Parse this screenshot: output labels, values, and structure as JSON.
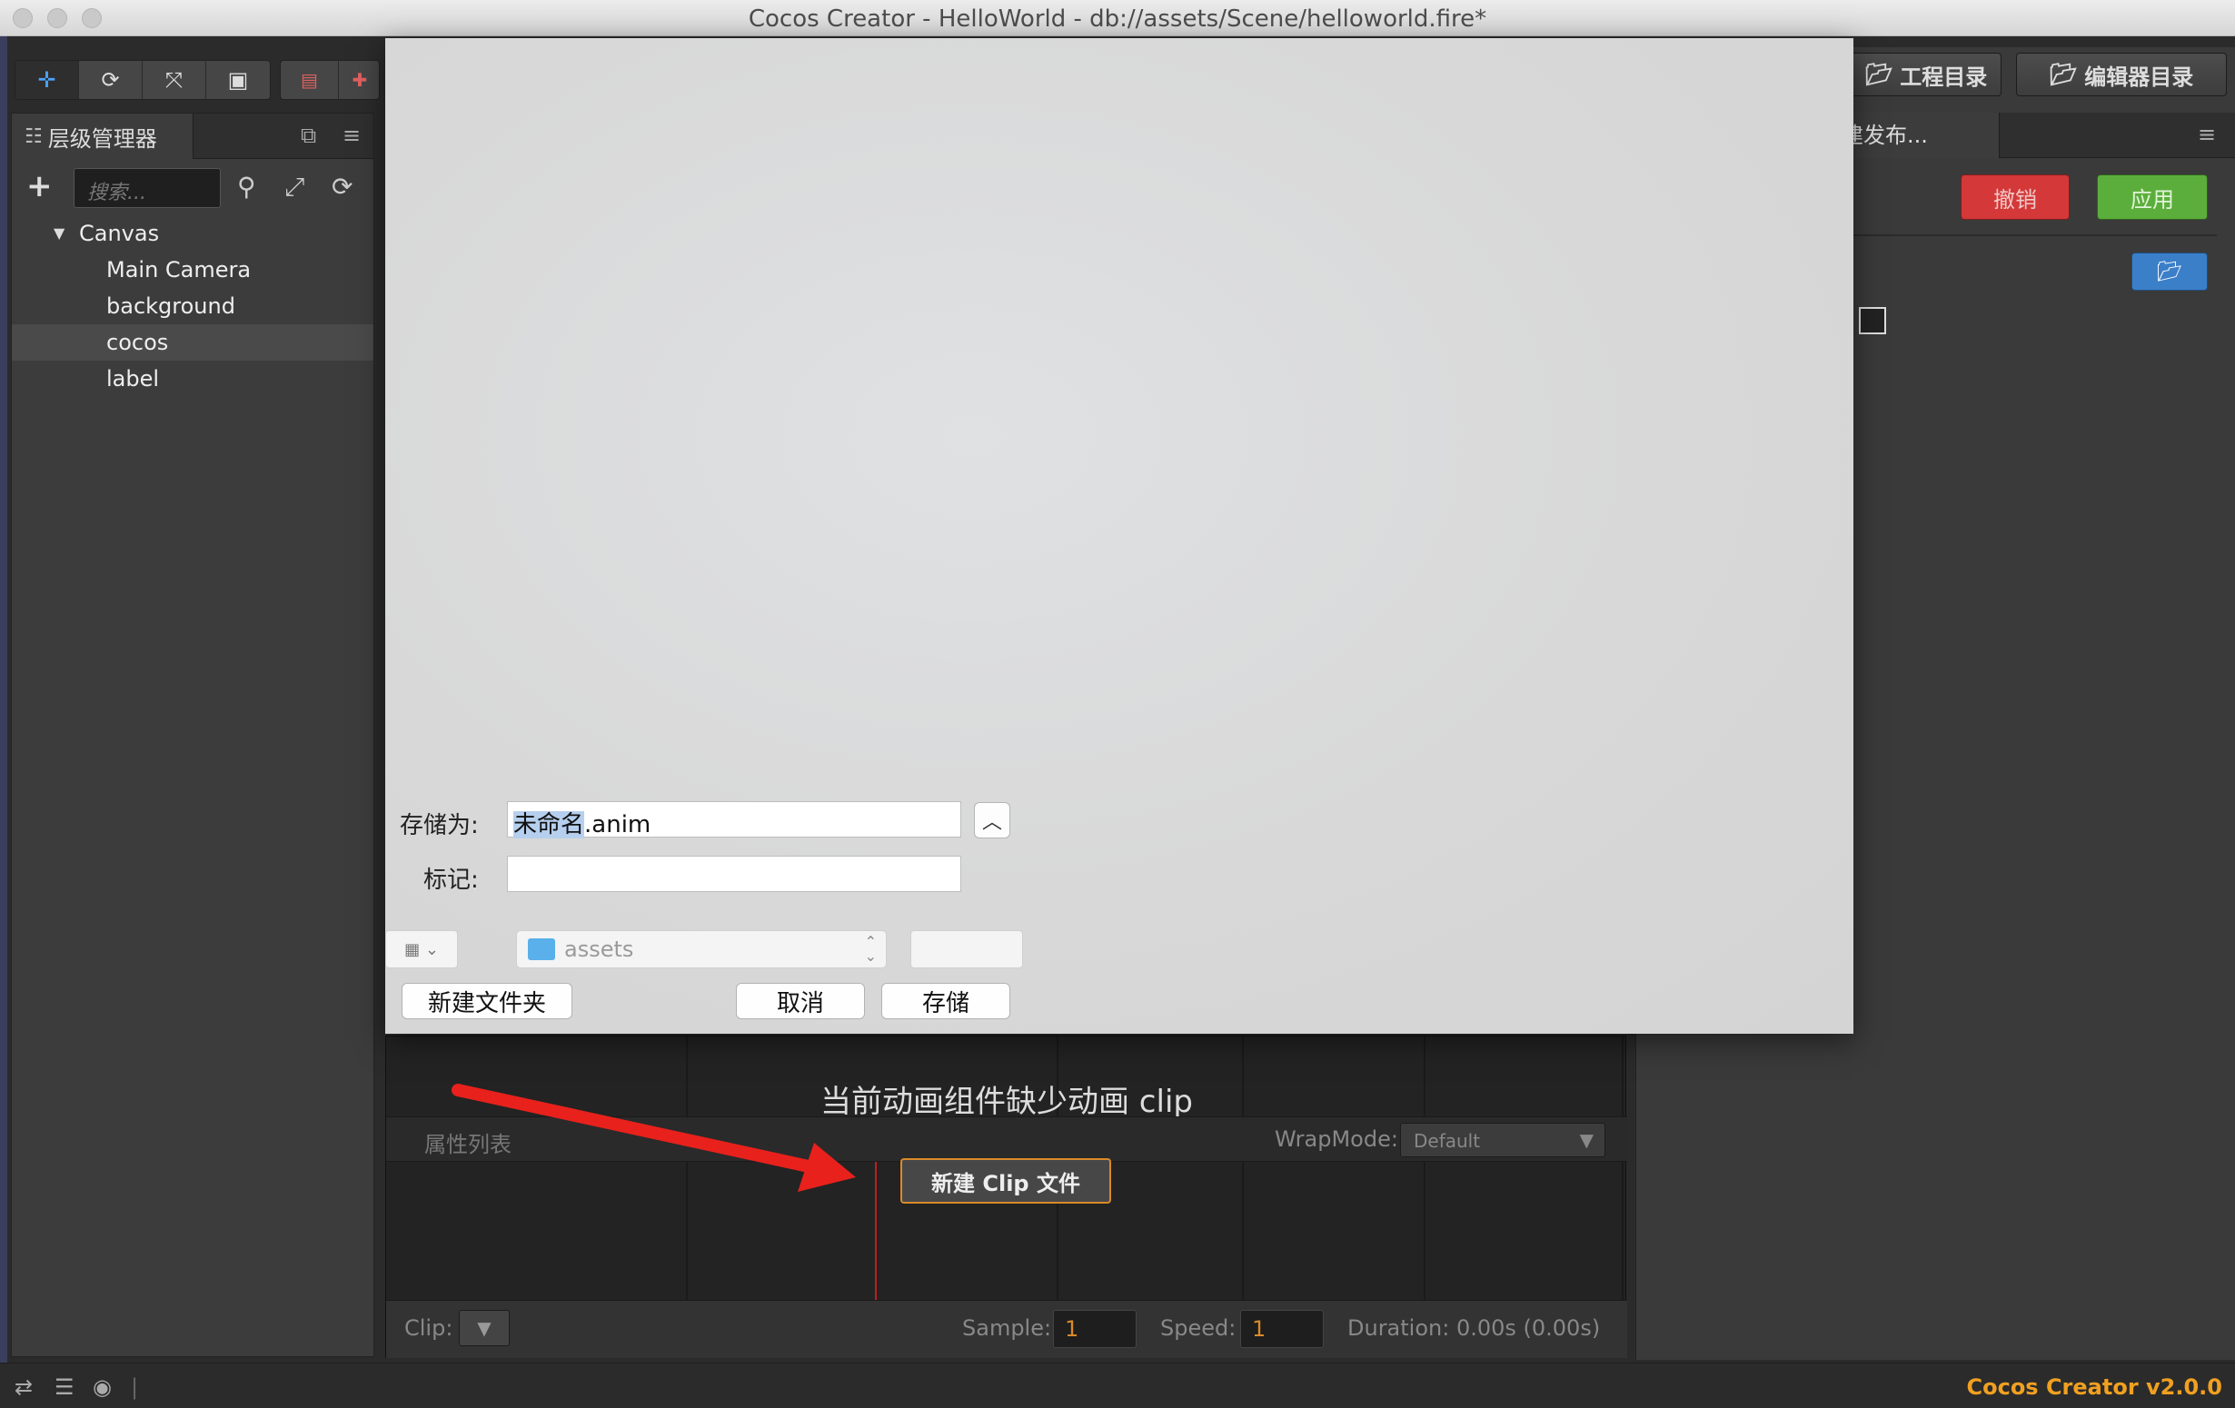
{
  "window": {
    "title": "Cocos Creator - HelloWorld - db://assets/Scene/helloworld.fire*"
  },
  "toolbar": {
    "tools": [
      "move-tool",
      "rotate-tool",
      "scale-tool",
      "rect-tool"
    ],
    "gizmo_buttons": [
      "anchor-toggle",
      "coordinate-toggle"
    ]
  },
  "top_right": {
    "project_dir_label": "工程目录",
    "editor_dir_label": "编辑器目录"
  },
  "hierarchy": {
    "tab_label": "层级管理器",
    "search_placeholder": "搜索...",
    "nodes": [
      {
        "label": "Canvas",
        "expanded": true,
        "depth": 0
      },
      {
        "label": "Main Camera",
        "depth": 1
      },
      {
        "label": "background",
        "depth": 1
      },
      {
        "label": "cocos",
        "depth": 1,
        "selected": true
      },
      {
        "label": "label",
        "depth": 1
      }
    ]
  },
  "right_panel": {
    "tab_label": "建发布...",
    "revert_label": "撤销",
    "apply_label": "应用",
    "revert_color": "#d43838",
    "apply_color": "#5cae3c"
  },
  "save_dialog": {
    "save_as_label": "存储为:",
    "filename_highlight": "未命名",
    "filename_rest": ".anim",
    "tags_label": "标记:",
    "tags_value": "",
    "location": "assets",
    "new_folder_label": "新建文件夹",
    "cancel_label": "取消",
    "save_label": "存储"
  },
  "animation_editor": {
    "missing_clip_message": "当前动画组件缺少动画 clip",
    "property_list_label": "属性列表",
    "wrapmode_label": "WrapMode:",
    "wrapmode_value": "Default",
    "new_clip_label": "新建 Clip 文件",
    "clip_label": "Clip:",
    "sample_label": "Sample:",
    "sample_value": "1",
    "speed_label": "Speed:",
    "speed_value": "1",
    "duration_text": "Duration: 0.00s (0.00s)",
    "accent_color": "#d98a2a"
  },
  "status_bar": {
    "version": "Cocos Creator v2.0.0",
    "version_color": "#f0a020"
  },
  "annotation": {
    "arrow_color": "#e8211c"
  }
}
